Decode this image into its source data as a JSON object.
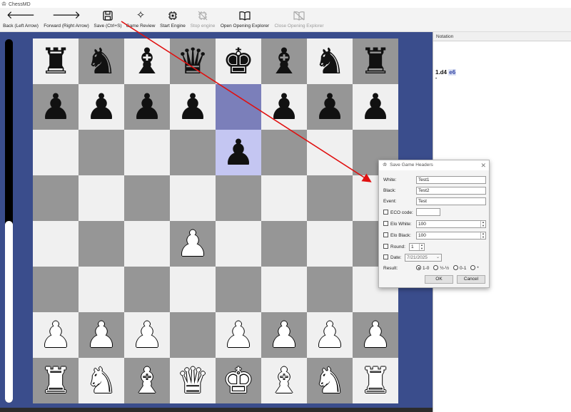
{
  "window": {
    "title": "ChessMD"
  },
  "toolbar": {
    "back": "Back (Left Arrow)",
    "forward": "Forward (Right Arrow)",
    "save": "Save (Ctrl+S)",
    "review": "Game Review",
    "start_engine": "Start Engine",
    "stop_engine": "Stop engine",
    "open_explorer": "Open Opening Explorer",
    "close_explorer": "Close Opening Explorer"
  },
  "eval": {
    "white_fraction": 0.5
  },
  "board": {
    "ranks": [
      [
        "r",
        "n",
        "b",
        "q",
        "k",
        "b",
        "n",
        "r"
      ],
      [
        "p",
        "p",
        "p",
        "p",
        "",
        "p",
        "p",
        "p"
      ],
      [
        "",
        "",
        "",
        "",
        "p",
        "",
        "",
        ""
      ],
      [
        "",
        "",
        "",
        "",
        "",
        "",
        "",
        ""
      ],
      [
        "",
        "",
        "",
        "P",
        "",
        "",
        "",
        ""
      ],
      [
        "",
        "",
        "",
        "",
        "",
        "",
        "",
        ""
      ],
      [
        "P",
        "P",
        "P",
        "",
        "P",
        "P",
        "P",
        "P"
      ],
      [
        "R",
        "N",
        "B",
        "Q",
        "K",
        "B",
        "N",
        "R"
      ]
    ],
    "highlight": [
      "e7",
      "e6"
    ]
  },
  "notation": {
    "header": "Notation",
    "white_move": "1.d4",
    "black_move": "e6",
    "cursor_marker": "•"
  },
  "dialog": {
    "title": "Save Game Headers",
    "white_label": "White:",
    "white_value": "Test1",
    "black_label": "Black:",
    "black_value": "Test2",
    "event_label": "Event:",
    "event_value": "Test",
    "eco_label": "ECO code:",
    "eco_value": "",
    "elo_white_label": "Elo White:",
    "elo_white_value": "100",
    "elo_black_label": "Elo Black:",
    "elo_black_value": "100",
    "round_label": "Round:",
    "round_value": "1",
    "date_label": "Date:",
    "date_value": "7/21/2025",
    "result_label": "Result:",
    "results": [
      "1-0",
      "½-½",
      "0-1",
      "*"
    ],
    "selected_result": "1-0",
    "ok": "OK",
    "cancel": "Cancel"
  }
}
